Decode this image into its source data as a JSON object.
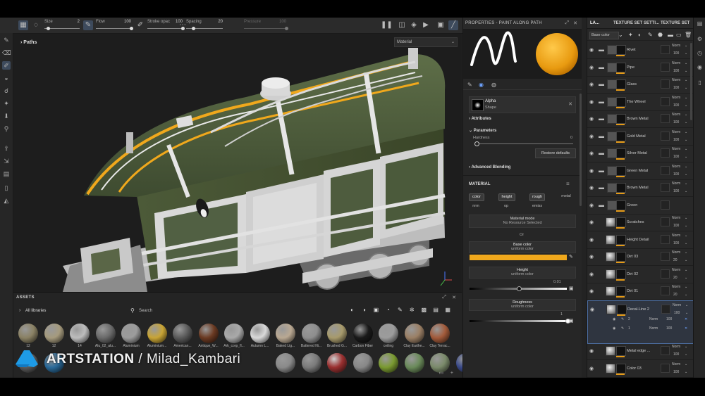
{
  "toolbar": {
    "size_label": "Size",
    "size_value": "2",
    "flow_label": "Flow",
    "flow_value": "100",
    "stroke_label": "Stroke opac",
    "stroke_value": "100",
    "spacing_label": "Spacing",
    "spacing_value": "20",
    "pressure_label": "Pressure",
    "pressure_value": "100"
  },
  "viewport": {
    "paths_label": "Paths",
    "material_select": "Material"
  },
  "assets": {
    "title": "ASSETS",
    "library": "All libraries",
    "search_placeholder": "Search",
    "items": [
      {
        "name": "12",
        "color": "#8a8164"
      },
      {
        "name": "12",
        "color": "#a59a7d"
      },
      {
        "name": "14",
        "color": "#bdbdbd"
      },
      {
        "name": "Alu_02_alu...",
        "color": "#6a6a6a"
      },
      {
        "name": "Aluminium",
        "color": "#9c9c9c"
      },
      {
        "name": "Aluminium...",
        "color": "#c8a435"
      },
      {
        "name": "American...",
        "color": "#5a5a5a"
      },
      {
        "name": "Antique_W...",
        "color": "#6b3a22"
      },
      {
        "name": "Ark_corp_fl...",
        "color": "#a9a9a9"
      },
      {
        "name": "Autumn L...",
        "color": "#d9d9d9"
      },
      {
        "name": "Baked Lig...",
        "color": "#b9a892"
      },
      {
        "name": "Battered Ni...",
        "color": "#8e8e8e"
      },
      {
        "name": "Brushed G...",
        "color": "#a79a6c"
      },
      {
        "name": "Carbon Fiber",
        "color": "#1a1a1a"
      },
      {
        "name": "ceiling",
        "color": "#9c9c9c"
      },
      {
        "name": "Clay Earthe...",
        "color": "#9a7f65"
      },
      {
        "name": "Clay Terrac...",
        "color": "#a25a3a"
      }
    ],
    "row2_colors": [
      "#5a5a5a",
      "#2a6a9a",
      "#8a8a8a",
      "#7a7a7a",
      "#8a8a8a",
      "#9a3030",
      "#888888",
      "#7a9a30",
      "#6a8a5a",
      "#7a8a6a",
      "#3a4a8a"
    ]
  },
  "watermark": {
    "brand": "ARTSTATION",
    "sep": " / ",
    "author": "Milad_Kambari"
  },
  "properties": {
    "title": "PROPERTIES - PAINT ALONG PATH",
    "alpha_label": "Alpha",
    "alpha_sub": "Shape",
    "attributes": "Attributes",
    "parameters": "Parameters",
    "hardness_label": "Hardness",
    "hardness_value": "0",
    "restore_defaults": "Restore defaults",
    "advanced_blending": "Advanced Blending",
    "material_header": "MATERIAL",
    "channels": [
      "color",
      "height",
      "rough",
      "metal",
      "nrm",
      "op",
      "emiss"
    ],
    "material_mode_label": "Material mode",
    "material_mode_value": "No Resource Selected",
    "or_text": "Or",
    "base_color_label": "Base color",
    "base_color_sub": "uniform color",
    "base_color_hex": "#f0a81c",
    "height_label": "Height",
    "height_sub": "uniform color",
    "height_value": "0.01",
    "height_level": 0.5,
    "roughness_label": "Roughness",
    "roughness_sub": "uniform color",
    "roughness_value": "1",
    "roughness_level": 1.0
  },
  "layers_panel": {
    "tabs": [
      "LA...",
      "TEXTURE SET SETTI...",
      "TEXTURE SET"
    ],
    "channel_select": "Base color",
    "rows": [
      {
        "name": "Rivet",
        "blend": "Norm",
        "opacity": "100",
        "type": "folder"
      },
      {
        "name": "Pipe",
        "blend": "Norm",
        "opacity": "100",
        "type": "folder"
      },
      {
        "name": "Glass",
        "blend": "Norm",
        "opacity": "100",
        "type": "folder"
      },
      {
        "name": "The Wheel",
        "blend": "Norm",
        "opacity": "100",
        "type": "folder"
      },
      {
        "name": "Brown Metal",
        "blend": "Norm",
        "opacity": "100",
        "type": "folder"
      },
      {
        "name": "Gold Metal",
        "blend": "Norm",
        "opacity": "100",
        "type": "folder"
      },
      {
        "name": "Silver Metal",
        "blend": "Norm",
        "opacity": "100",
        "type": "folder"
      },
      {
        "name": "Green Metal",
        "blend": "Norm",
        "opacity": "100",
        "type": "folder"
      },
      {
        "name": "Brown Metal",
        "blend": "Norm",
        "opacity": "100",
        "type": "folder"
      },
      {
        "name": "Green",
        "blend": "",
        "opacity": "",
        "type": "folder"
      },
      {
        "name": "Scratches",
        "blend": "Norm",
        "opacity": "100",
        "type": "layer"
      },
      {
        "name": "Height Detail",
        "blend": "Norm",
        "opacity": "100",
        "type": "layer"
      },
      {
        "name": "Dirt 03",
        "blend": "Norm",
        "opacity": "20",
        "type": "layer"
      },
      {
        "name": "Dirt 02",
        "blend": "Norm",
        "opacity": "20",
        "type": "layer"
      },
      {
        "name": "Dirt 01",
        "blend": "Norm",
        "opacity": "20",
        "type": "layer"
      }
    ],
    "selected": {
      "name": "Decal-Line 2",
      "blend": "Norm",
      "opacity": "100"
    },
    "sublayers": [
      {
        "index": "2",
        "blend": "Norm",
        "opacity": "100"
      },
      {
        "index": "1",
        "blend": "Norm",
        "opacity": "100"
      }
    ],
    "after": [
      {
        "name": "Metal edge ...",
        "blend": "Norm",
        "opacity": "100"
      },
      {
        "name": "Color 03",
        "blend": "Norm",
        "opacity": "100"
      }
    ]
  }
}
